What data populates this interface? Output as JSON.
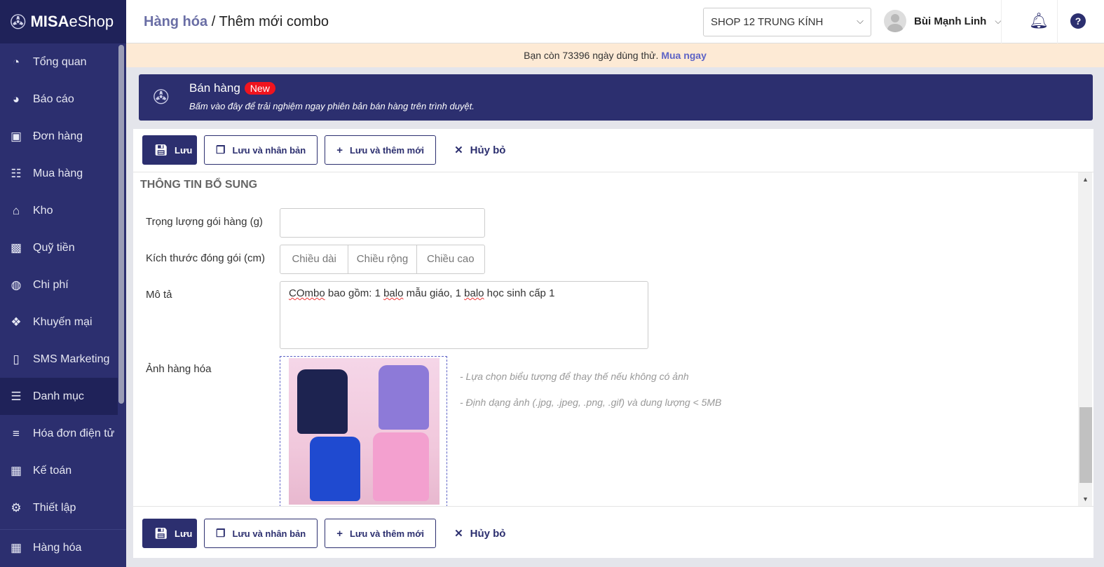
{
  "brand": {
    "name_bold": "MISA",
    "name_rest": "eShop"
  },
  "sidebar": {
    "items": [
      {
        "label": "Tổng quan",
        "icon": "dashboard-icon"
      },
      {
        "label": "Báo cáo",
        "icon": "pie-chart-icon"
      },
      {
        "label": "Đơn hàng",
        "icon": "truck-icon"
      },
      {
        "label": "Mua hàng",
        "icon": "cart-icon"
      },
      {
        "label": "Kho",
        "icon": "warehouse-icon"
      },
      {
        "label": "Quỹ tiền",
        "icon": "safe-icon"
      },
      {
        "label": "Chi phí",
        "icon": "money-bag-icon"
      },
      {
        "label": "Khuyến mại",
        "icon": "gift-icon"
      },
      {
        "label": "SMS Marketing",
        "icon": "phone-icon"
      },
      {
        "label": "Danh mục",
        "icon": "list-icon"
      },
      {
        "label": "Hóa đơn điện tử",
        "icon": "invoice-icon"
      },
      {
        "label": "Kế toán",
        "icon": "calculator-icon"
      },
      {
        "label": "Thiết lập",
        "icon": "gear-icon"
      }
    ],
    "bottom": {
      "label": "Hàng hóa",
      "icon": "boxes-icon"
    }
  },
  "header": {
    "parent": "Hàng hóa",
    "separator": "/",
    "title": "Thêm mới combo",
    "shop": "SHOP 12 TRUNG KÍNH",
    "user": "Bùi Mạnh Linh"
  },
  "trial": {
    "text": "Bạn còn 73396 ngày dùng thử.",
    "link": "Mua ngay"
  },
  "promo": {
    "title": "Bán hàng",
    "badge": "New",
    "subtitle": "Bấm vào đây để trải nghiệm ngay phiên bản bán hàng trên trình duyệt."
  },
  "toolbar": {
    "save": "Lưu",
    "save_duplicate": "Lưu và nhân bản",
    "save_new": "Lưu và thêm mới",
    "cancel": "Hủy bỏ"
  },
  "form": {
    "section": "THÔNG TIN BỔ SUNG",
    "weight_label": "Trọng lượng gói hàng (g)",
    "weight_value": "",
    "size_label": "Kích thước đóng gói (cm)",
    "length_ph": "Chiều dài",
    "width_ph": "Chiều rộng",
    "height_ph": "Chiều cao",
    "desc_label": "Mô tả",
    "desc_w1": "COmbo",
    "desc_w2": " bao gồm: 1 ",
    "desc_w3": "balo",
    "desc_w4": " mẫu giáo, 1 ",
    "desc_w5": "balo",
    "desc_w6": " học sinh cấp 1",
    "image_label": "Ảnh hàng hóa",
    "hint1": "- Lựa chọn biểu tượng để thay thế nếu không có ảnh",
    "hint2": "- Định dạng ảnh (.jpg, .jpeg, .png, .gif) và dung lượng < 5MB"
  },
  "colors": {
    "primary": "#2c2f6f",
    "badge": "#f0141e",
    "trial_bg": "#fdead5",
    "link": "#5d63c6"
  }
}
